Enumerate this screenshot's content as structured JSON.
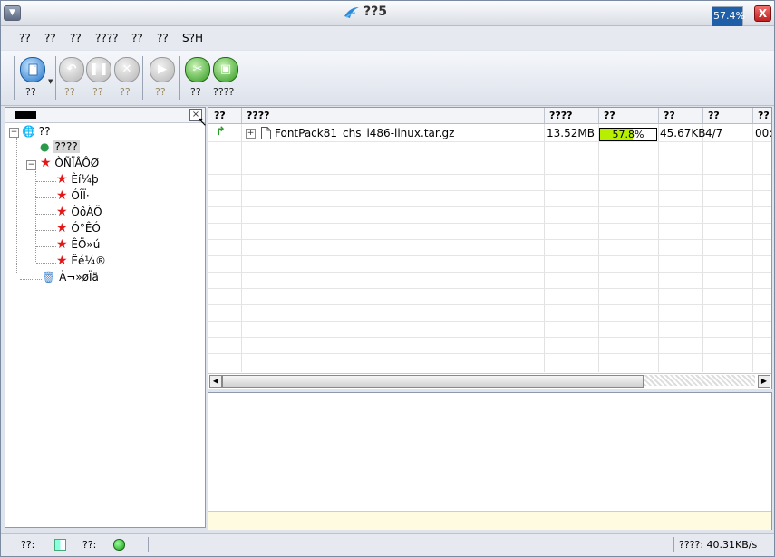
{
  "window": {
    "title": "??5",
    "tray_percent": "57.4%",
    "close_glyph": "X",
    "menu_glyph": "▼"
  },
  "menu": [
    "??",
    "??",
    "??",
    "????",
    "??",
    "??",
    "S?H"
  ],
  "toolbar": {
    "buttons": [
      {
        "label": "??",
        "icon": "new-task-icon",
        "enabled": true
      },
      {
        "label": "??",
        "icon": "undo-icon",
        "enabled": false
      },
      {
        "label": "??",
        "icon": "pause-icon",
        "enabled": false
      },
      {
        "label": "??",
        "icon": "stop-icon",
        "enabled": false
      },
      {
        "label": "??",
        "icon": "play-icon",
        "enabled": false
      },
      {
        "label": "??",
        "icon": "tools-icon",
        "enabled": true
      },
      {
        "label": "????",
        "icon": "monitor-icon",
        "enabled": true
      }
    ]
  },
  "tree": {
    "root": "??",
    "selected": "????",
    "category": "ÒÑÏÂÔØ",
    "children": [
      "Èí¼þ",
      "ÓÎÏ·",
      "ÒôÀÖ",
      "Ó°ÊÓ",
      "ÊÖ»ú",
      "Êé¼®"
    ],
    "trash": "À¬»øÏä"
  },
  "table": {
    "columns": [
      "??",
      "????",
      "????",
      "??",
      "??",
      "??",
      "??"
    ],
    "rows": [
      {
        "name": "FontPack81_chs_i486-linux.tar.gz",
        "size": "13.52MB",
        "progress_text": "57.8%",
        "progress": 0.578,
        "speed": "45.67KB",
        "blocks": "4/7",
        "time": "00:"
      }
    ]
  },
  "status": {
    "label1": "??:",
    "label2": "??:",
    "speed": "????: 40.31KB/s"
  },
  "colors": {
    "progress_fill": "#b8ef00",
    "star": "#e21818",
    "close": "#c02020"
  }
}
